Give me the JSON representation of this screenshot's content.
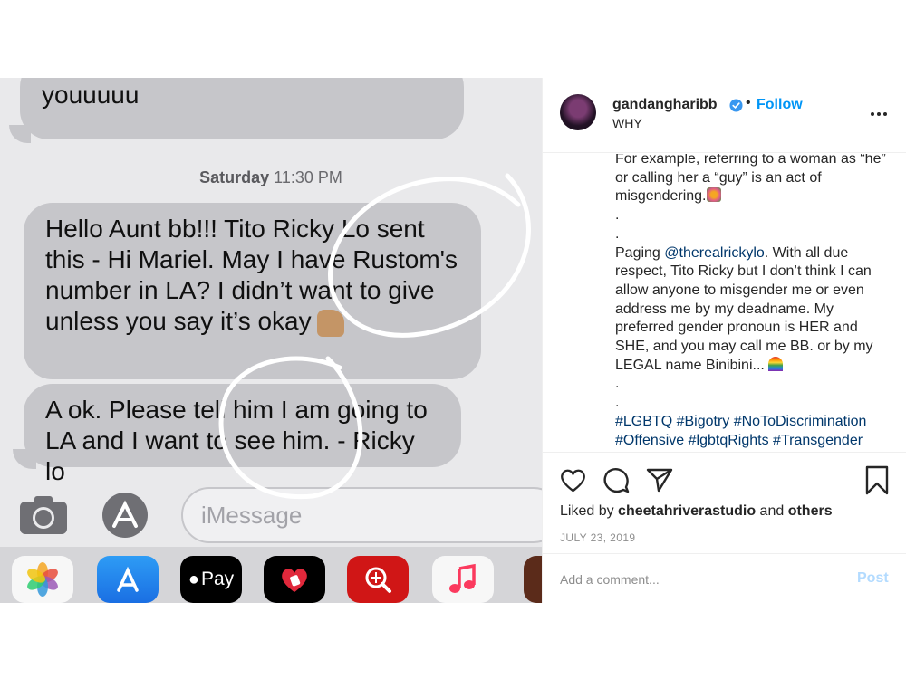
{
  "messages": {
    "bubble1_text": "know you are doing okay!!!! Miss\nyouuuuu",
    "timestamp_day": "Saturday",
    "timestamp_time": "11:30 PM",
    "bubble2_text": "Hello Aunt bb!!! Tito Ricky Lo sent\nthis - Hi Mariel. May I have Rustom's\nnumber in LA? I didn’t want to give\nunless you say it’s okay",
    "bubble3_text": "A ok. Please tell him I am going to\nLA and I want to see him. - Ricky lo",
    "compose_placeholder": "iMessage",
    "applepay_label": "Pay"
  },
  "instagram": {
    "username": "gandangharibb",
    "follow_label": "Follow",
    "location": "WHY",
    "caption": {
      "line_cut": "... a woman as ... misgendering.",
      "p1a": "For example, referring to a woman as “he” or calling her a “guy” is an act of misgendering.",
      "dot1": ".",
      "dot2": ".",
      "p2_prefix": "Paging ",
      "p2_mention": "@therealrickylo",
      "p2_rest": ". With all due respect, Tito Ricky but I don’t think I can allow anyone to misgender me or even address me by my deadname. My preferred gender pronoun is HER and SHE, and you may call me BB. or by my LEGAL name Binibini...",
      "dot3": ".",
      "dot4": ".",
      "hashtags": "#LGBTQ #Bigotry #NoToDiscrimination #Offensive #lgbtqRights #Transgender"
    },
    "liked_by_prefix": "Liked by ",
    "liked_by_user": "cheetahriverastudio",
    "liked_by_and": " and ",
    "liked_by_others": "others",
    "date": "JULY 23, 2019",
    "comment_placeholder": "Add a comment...",
    "post_label": "Post",
    "colors": {
      "link": "#00376b",
      "follow": "#0095f6",
      "post_disabled": "#b3dbff"
    }
  }
}
